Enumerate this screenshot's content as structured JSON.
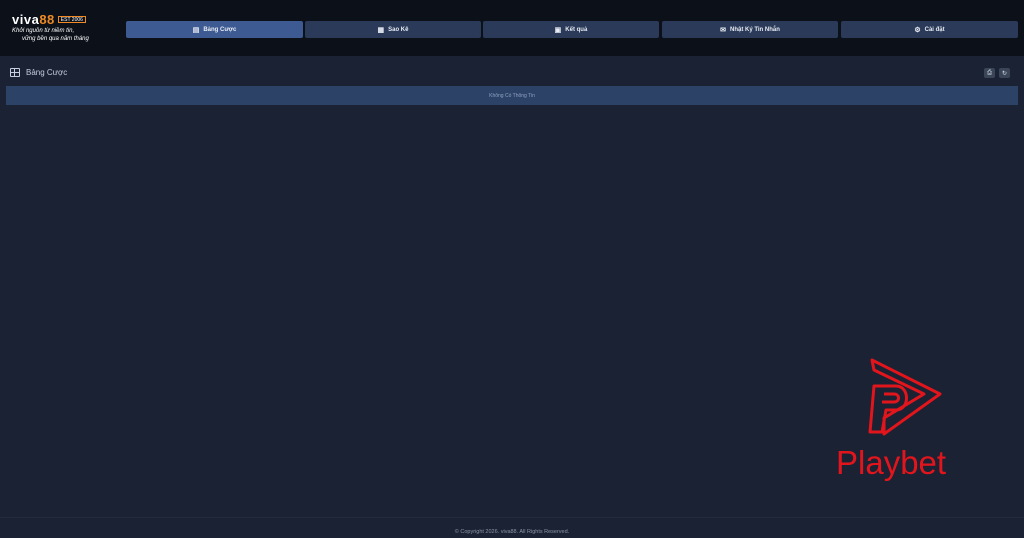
{
  "brand": {
    "logo_text_main": "viva",
    "logo_text_accent": "88",
    "badge": "EST 2006",
    "slogan_line1": "Khởi nguồn từ niềm tin,",
    "slogan_line2": "vững bền qua năm tháng"
  },
  "nav": {
    "items": [
      {
        "label": "Bảng Cược",
        "icon": "table-icon",
        "active": true
      },
      {
        "label": "Sao Kê",
        "icon": "document-icon",
        "active": false
      },
      {
        "label": "Kết quả",
        "icon": "results-icon",
        "active": false
      },
      {
        "label": "Nhật Ký Tin Nhắn",
        "icon": "envelope-icon",
        "active": false
      },
      {
        "label": "Cài đặt",
        "icon": "gear-icon",
        "active": false
      }
    ]
  },
  "pane": {
    "title": "Bảng Cược",
    "empty_message": "Không Có Thông Tin"
  },
  "footer": {
    "copyright": "© Copyright 2026. viva88. All Rights Reserved."
  },
  "watermark": {
    "text": "Playbet",
    "color": "#e3151c"
  },
  "colors": {
    "active_tab": "#3d5a92",
    "tab": "#2a3a58",
    "background": "#1a2233",
    "accent": "#f08a24"
  }
}
